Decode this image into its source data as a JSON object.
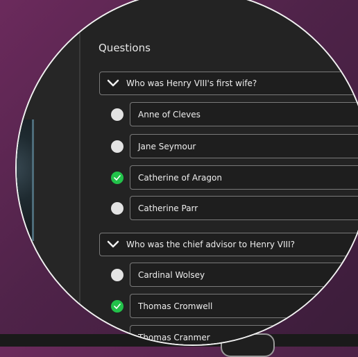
{
  "section_title": "Questions",
  "questions": [
    {
      "text": "Who was Henry VIII's first wife?",
      "options": [
        {
          "label": "Anne of Cleves",
          "correct": false
        },
        {
          "label": "Jane Seymour",
          "correct": false
        },
        {
          "label": "Catherine of Aragon",
          "correct": true
        },
        {
          "label": "Catherine Parr",
          "correct": false
        }
      ]
    },
    {
      "text": "Who was the chief advisor to Henry VIII?",
      "options": [
        {
          "label": "Cardinal Wolsey",
          "correct": false
        },
        {
          "label": "Thomas Cromwell",
          "correct": true
        },
        {
          "label": "Thomas Cranmer",
          "correct": false
        }
      ]
    }
  ],
  "colors": {
    "correct": "#22c24a",
    "unselected": "#e3e3e3",
    "panel": "#232323"
  },
  "icons": {
    "expand": "chevron-down-icon",
    "correct_mark": "check-icon"
  }
}
